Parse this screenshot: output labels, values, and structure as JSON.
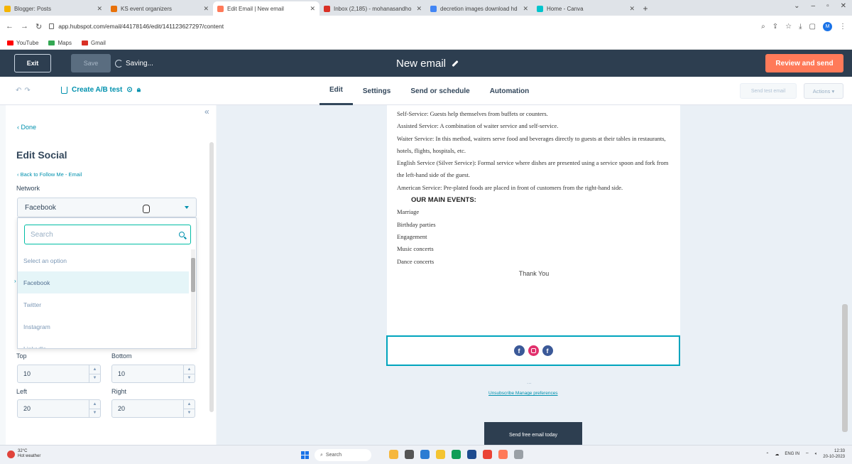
{
  "browser": {
    "tabs": [
      {
        "title": "Blogger: Posts",
        "color": "#f4b400",
        "active": false
      },
      {
        "title": "KS event organizers",
        "color": "#e8710a",
        "active": false
      },
      {
        "title": "Edit Email | New email",
        "color": "#ff7a59",
        "active": true
      },
      {
        "title": "Inbox (2,185) - mohanasandho",
        "color": "#d93025",
        "active": false
      },
      {
        "title": "decretion images download hd",
        "color": "#4285f4",
        "active": false
      },
      {
        "title": "Home - Canva",
        "color": "#00c4cc",
        "active": false
      }
    ],
    "url": "app.hubspot.com/email/44178146/edit/141123627297/content",
    "bookmarks": [
      {
        "label": "YouTube",
        "color": "#ff0000"
      },
      {
        "label": "Maps",
        "color": "#34a853"
      },
      {
        "label": "Gmail",
        "color": "#d93025"
      }
    ],
    "profile_initial": "M"
  },
  "header": {
    "exit_label": "Exit",
    "save_label": "Save",
    "saving_label": "Saving...",
    "email_title": "New email",
    "review_label": "Review and send"
  },
  "toolbar": {
    "undo": "↶",
    "redo": "↷",
    "ab_test_label": "Create A/B test",
    "tabs": [
      "Edit",
      "Settings",
      "Send or schedule",
      "Automation"
    ],
    "active_tab": "Edit",
    "send_test_label": "Send test email",
    "actions_label": "Actions ▾"
  },
  "panel": {
    "collapse": "«",
    "done_label": "‹  Done",
    "title": "Edit Social",
    "back_label": "‹  Back to Follow Me - Email",
    "network_label": "Network",
    "network_value": "Facebook",
    "search_placeholder": "Search",
    "options": [
      "Select an option",
      "Facebook",
      "Twitter",
      "Instagram",
      "LinkedIn"
    ],
    "selected_option": "Facebook",
    "padding": {
      "top_label": "Top",
      "top_value": "10",
      "bottom_label": "Bottom",
      "bottom_value": "10",
      "left_label": "Left",
      "left_value": "20",
      "right_label": "Right",
      "right_value": "20"
    }
  },
  "email": {
    "paragraphs": [
      "Self-Service: Guests help themselves from buffets or counters.",
      "Assisted Service: A combination of waiter service and self-service.",
      "Waiter Service: In this method, waiters serve food and beverages directly to guests at their tables in restaurants, hotels, flights, hospitals, etc.",
      "English Service (Silver Service): Formal service where dishes are presented using a service spoon and fork from the left-hand side of the guest.",
      "American Service: Pre-plated foods are placed in front of customers from the right-hand side."
    ],
    "events_heading": "OUR MAIN EVENTS:",
    "events": [
      "Marriage",
      "Birthday parties",
      "Engagement",
      "Music concerts",
      "Dance concerts"
    ],
    "thank_you": "Thank You",
    "dots": "...",
    "unsubscribe_label": "Unsubscribe  Manage preferences",
    "free_email_label": "Send free email today"
  },
  "taskbar": {
    "temperature": "32°C",
    "weather": "Hot weather",
    "search_label": "Search",
    "lang": "ENG IN",
    "time": "12:33",
    "date": "20-10-2023"
  }
}
